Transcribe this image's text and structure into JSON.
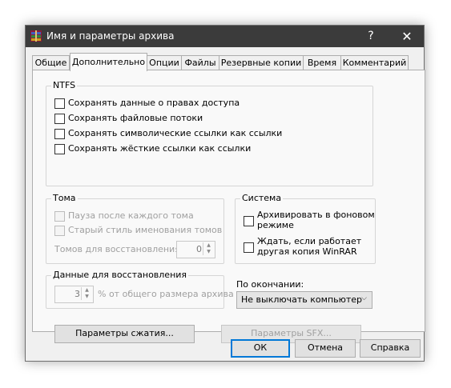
{
  "window": {
    "title": "Имя и параметры архива",
    "help": "?",
    "close": "✕"
  },
  "tabs": [
    {
      "label": "Общие"
    },
    {
      "label": "Дополнительно"
    },
    {
      "label": "Опции"
    },
    {
      "label": "Файлы"
    },
    {
      "label": "Резервные копии"
    },
    {
      "label": "Время"
    },
    {
      "label": "Комментарий"
    }
  ],
  "ntfs": {
    "title": "NTFS",
    "options": [
      {
        "label": "Сохранять данные о правах доступа",
        "checked": false
      },
      {
        "label": "Сохранять файловые потоки",
        "checked": false
      },
      {
        "label": "Сохранять символические ссылки как ссылки",
        "checked": false
      },
      {
        "label": "Сохранять жёсткие ссылки как ссылки",
        "checked": false
      }
    ]
  },
  "volumes": {
    "title": "Тома",
    "pause": "Пауза после каждого тома",
    "old_naming": "Старый стиль именования томов",
    "recovery_label": "Томов для восстановления:",
    "recovery_value": "0"
  },
  "system": {
    "title": "Система",
    "background_line1": "Архивировать в фоновом",
    "background_line2": "режиме",
    "wait_line1": "Ждать, если работает",
    "wait_line2": "другая копия WinRAR"
  },
  "recovery": {
    "title": "Данные для восстановления",
    "value": "3",
    "suffix": "% от общего размера архива"
  },
  "on_finish": {
    "label": "По окончании:",
    "selected": "Не выключать компьютер"
  },
  "buttons": {
    "compression": "Параметры сжатия...",
    "sfx": "Параметры SFX...",
    "ok": "ОК",
    "cancel": "Отмена",
    "help": "Справка"
  },
  "colors": {
    "titlebar": "#3b3b3b",
    "focus": "#0078d7"
  }
}
